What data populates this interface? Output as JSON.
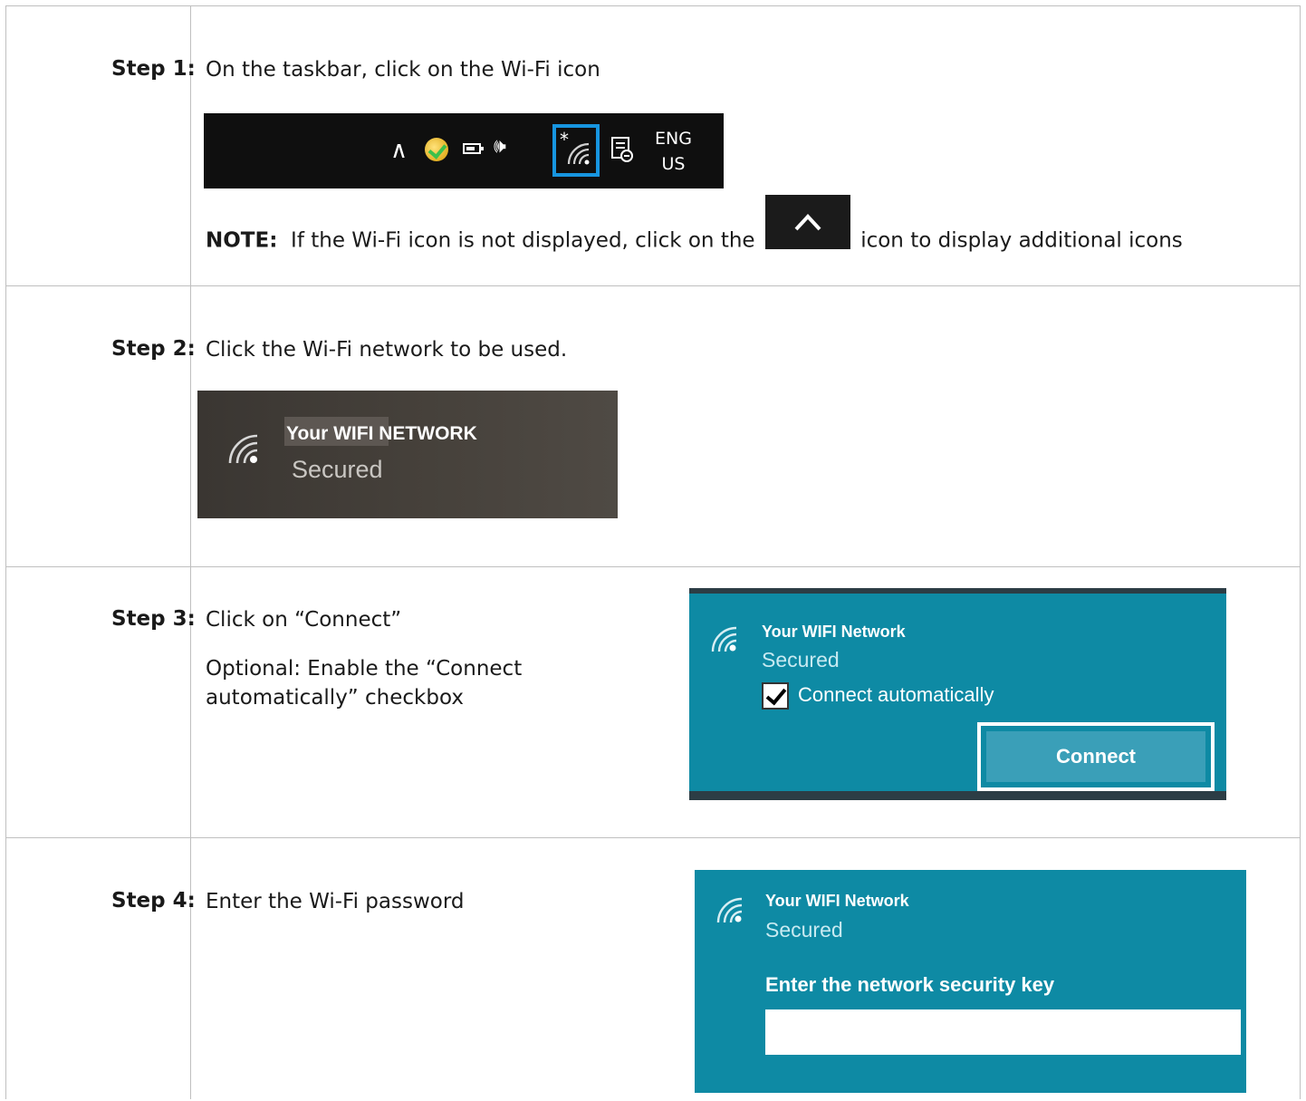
{
  "step1": {
    "label": "Step 1:",
    "text": "On the taskbar, click on the Wi-Fi icon",
    "taskbar": {
      "lang_top": "ENG",
      "lang_bottom": "US"
    },
    "note_bold": "NOTE:",
    "note_before": "If the Wi-Fi icon is not displayed, click on the",
    "note_after": "icon to display additional icons"
  },
  "step2": {
    "label": "Step 2:",
    "text": "Click the Wi-Fi network to be used.",
    "network_name": "Your WIFI NETWORK",
    "network_status": "Secured"
  },
  "step3": {
    "label": "Step 3:",
    "text1": "Click on “Connect”",
    "text2": "Optional: Enable the “Connect automatically” checkbox",
    "network_name": "Your WIFI Network",
    "network_status": "Secured",
    "checkbox_label": "Connect automatically",
    "checkbox_checked": true,
    "connect_label": "Connect"
  },
  "step4": {
    "label": "Step 4:",
    "text": "Enter the Wi-Fi password",
    "network_name": "Your WIFI Network",
    "network_status": "Secured",
    "key_label": "Enter the network security key",
    "key_value": ""
  },
  "colors": {
    "panel_teal": "#0e8aa4",
    "highlight_blue": "#1795e0",
    "taskbar_black": "#0f0f0f"
  },
  "icons": [
    "chevron-up-icon",
    "norton-icon",
    "battery-icon",
    "volume-icon",
    "wifi-icon",
    "notification-icon"
  ]
}
